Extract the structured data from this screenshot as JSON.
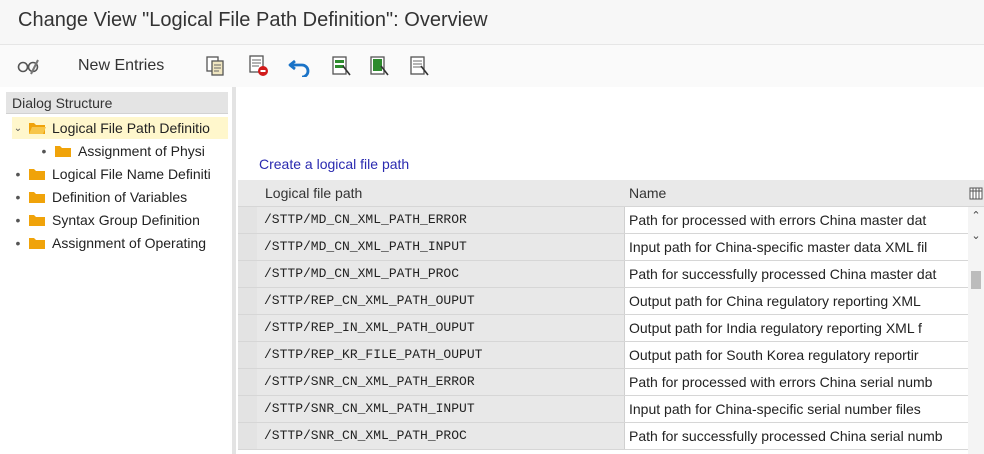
{
  "window": {
    "title": "Change View \"Logical File Path Definition\": Overview"
  },
  "toolbar": {
    "new_entries_label": "New Entries",
    "icons": [
      "glasses-icon",
      "copy-icon",
      "delete-icon",
      "undo-icon",
      "select-all-icon",
      "select-block-icon",
      "deselect-all-icon"
    ]
  },
  "dialog_structure": {
    "header": "Dialog Structure",
    "items": [
      {
        "label": "Logical File Path Definitio",
        "level": 0,
        "expanded": true,
        "selected": true
      },
      {
        "label": "Assignment of Physi",
        "level": 1
      },
      {
        "label": "Logical File Name Definiti",
        "level": 0
      },
      {
        "label": "Definition of Variables",
        "level": 0
      },
      {
        "label": "Syntax Group Definition",
        "level": 0
      },
      {
        "label": "Assignment of Operating",
        "level": 0
      }
    ]
  },
  "main": {
    "create_link": "Create a logical file path",
    "table": {
      "columns": [
        "Logical file path",
        "Name"
      ],
      "rows": [
        {
          "path": "/STTP/MD_CN_XML_PATH_ERROR",
          "name": "Path for processed with errors China master dat"
        },
        {
          "path": "/STTP/MD_CN_XML_PATH_INPUT",
          "name": "Input path for China-specific master data XML fil"
        },
        {
          "path": "/STTP/MD_CN_XML_PATH_PROC",
          "name": "Path for successfully processed China master dat"
        },
        {
          "path": "/STTP/REP_CN_XML_PATH_OUPUT",
          "name": "Output path for China regulatory reporting XML"
        },
        {
          "path": "/STTP/REP_IN_XML_PATH_OUPUT",
          "name": "Output path for India regulatory reporting XML f"
        },
        {
          "path": "/STTP/REP_KR_FILE_PATH_OUPUT",
          "name": "Output path for South Korea regulatory reportir"
        },
        {
          "path": "/STTP/SNR_CN_XML_PATH_ERROR",
          "name": "Path for processed with errors China serial numb"
        },
        {
          "path": "/STTP/SNR_CN_XML_PATH_INPUT",
          "name": "Input path for China-specific serial number files"
        },
        {
          "path": "/STTP/SNR_CN_XML_PATH_PROC",
          "name": "Path for successfully processed China serial numb"
        }
      ]
    }
  },
  "colors": {
    "link": "#2a2ab0",
    "folder": "#f0a30a",
    "selected_bg": "#fff7cc",
    "key_column_bg": "#e8e8e8"
  }
}
